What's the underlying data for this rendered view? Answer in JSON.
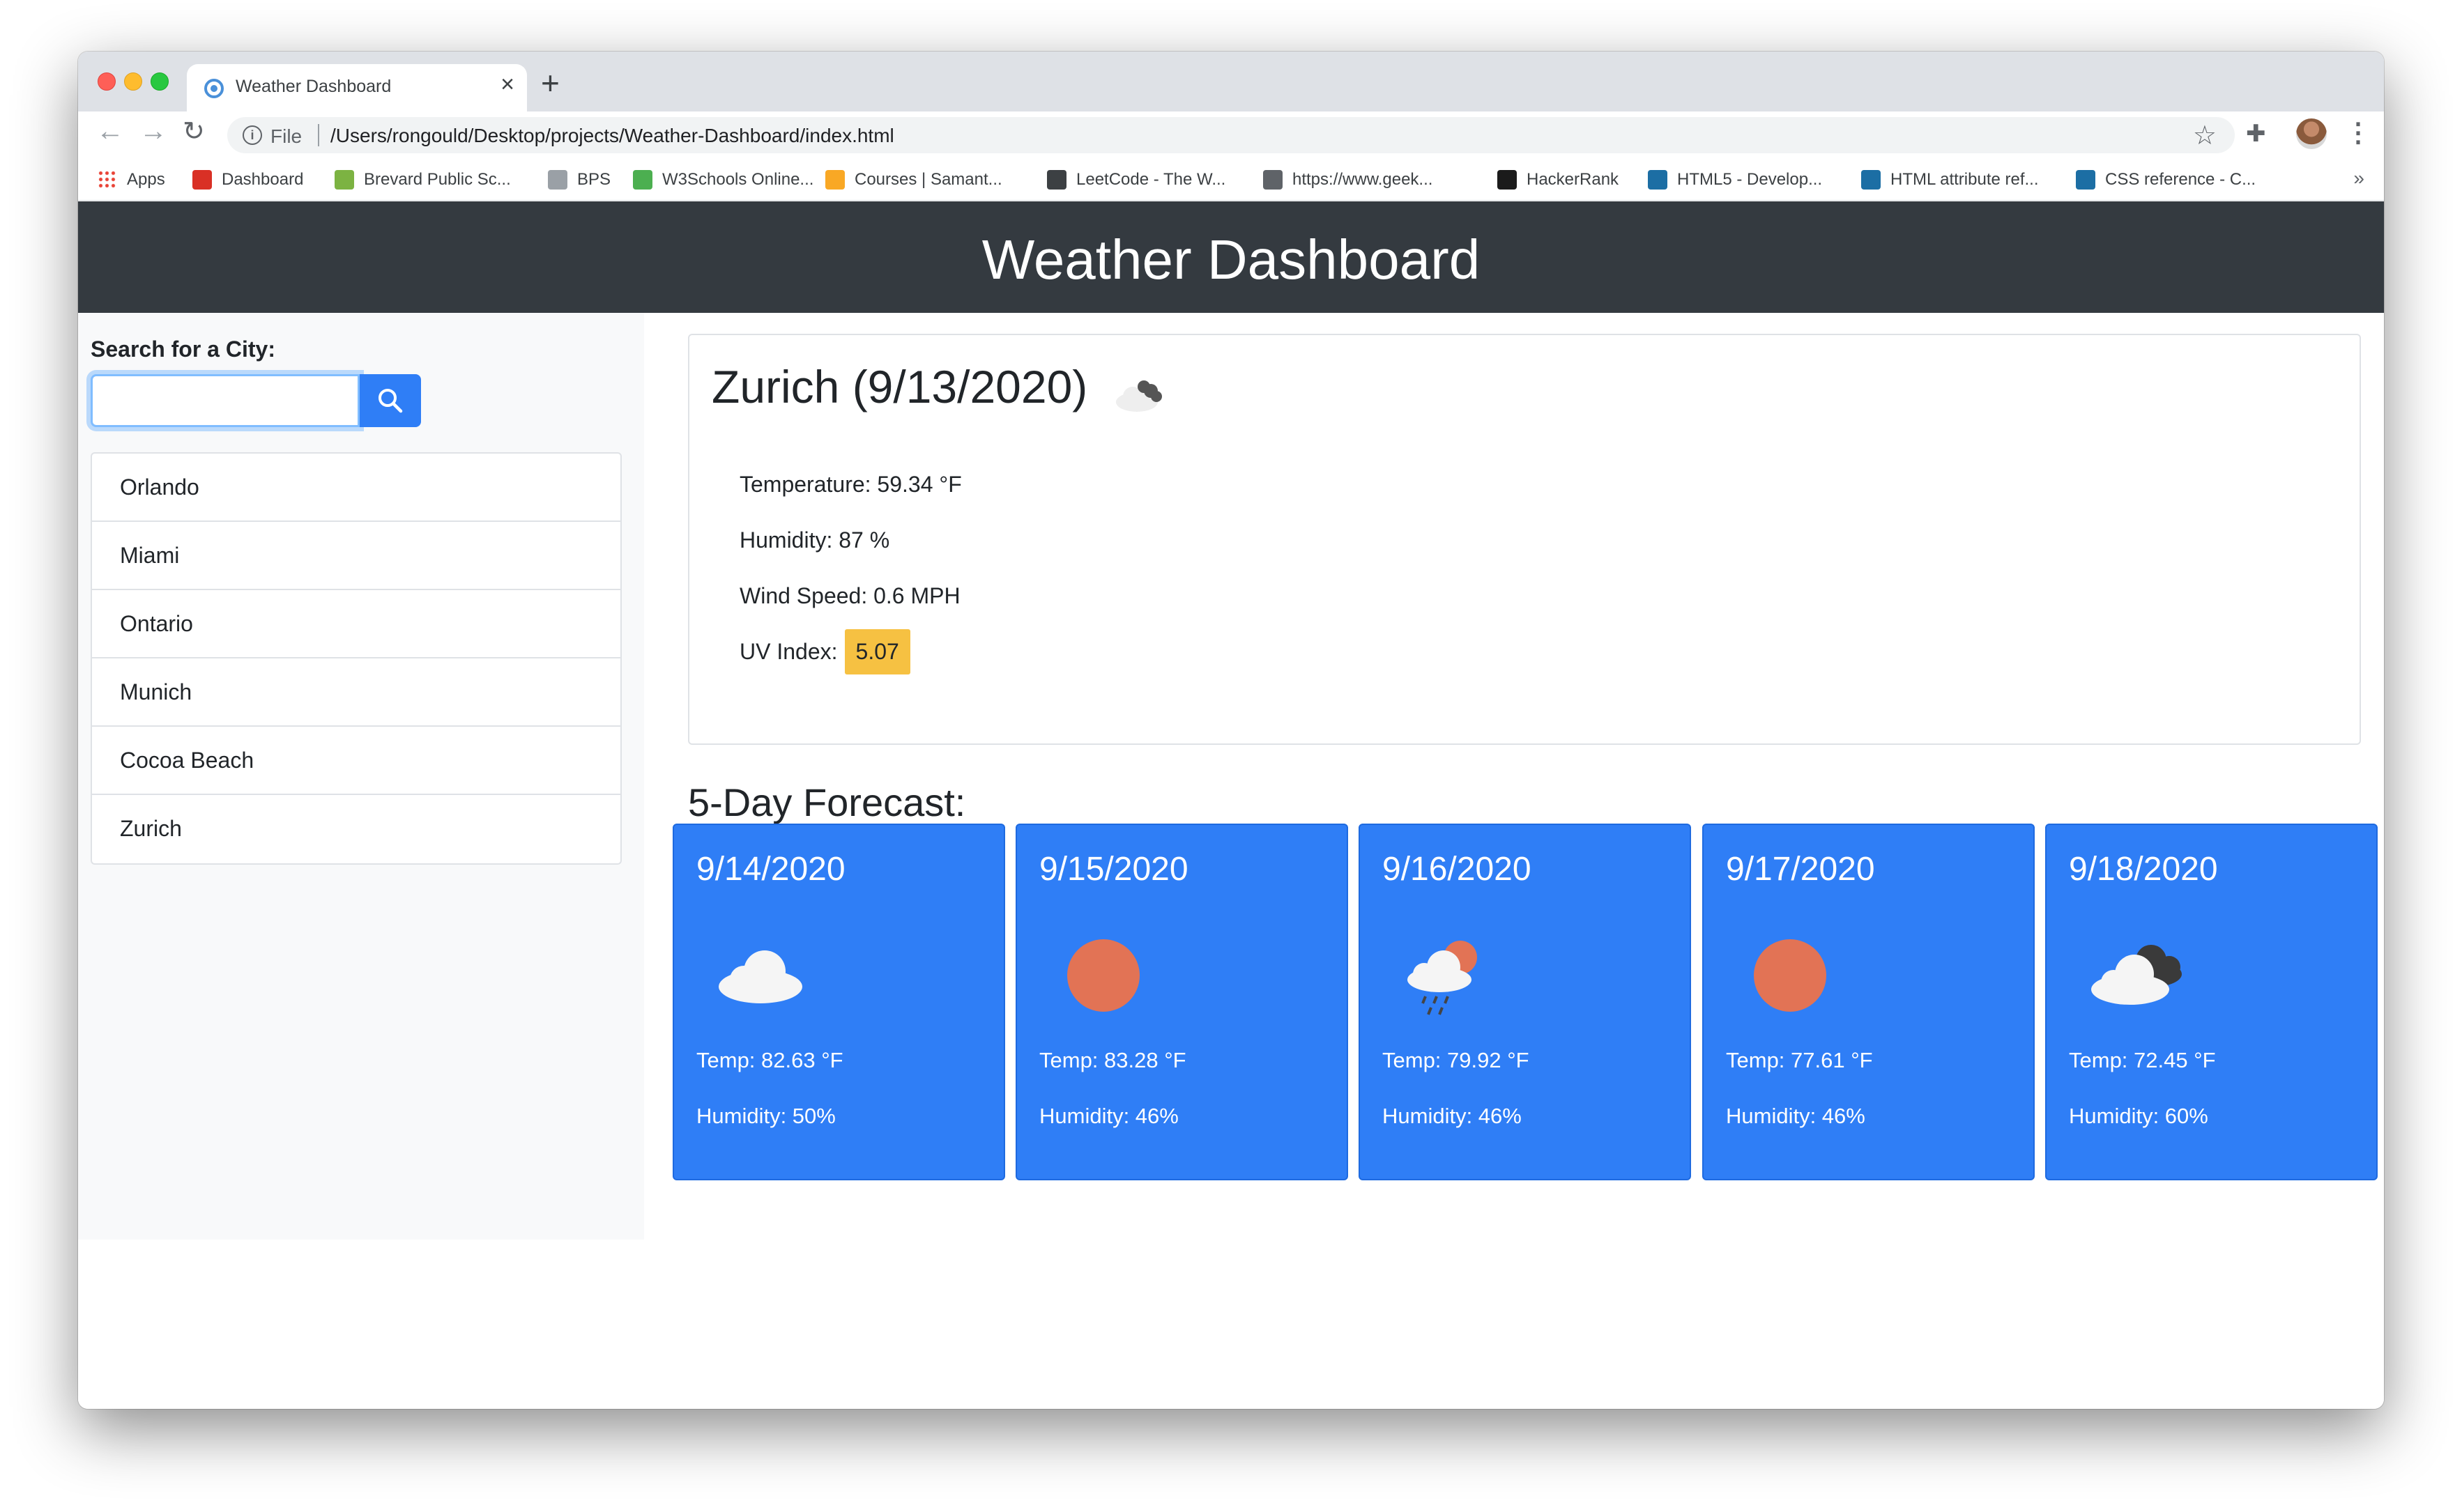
{
  "browser": {
    "tab_title": "Weather Dashboard",
    "tab_close": "×",
    "new_tab": "+",
    "omnibox_scheme": "File",
    "url": "/Users/rongould/Desktop/projects/Weather-Dashboard/index.html",
    "bookmarks": [
      {
        "label": "Apps",
        "icon": "apps-grid-icon",
        "color": "#e94235"
      },
      {
        "label": "Dashboard",
        "icon": "dashboard-icon",
        "color": "#d93025"
      },
      {
        "label": "Brevard Public Sc...",
        "icon": "brevard-icon",
        "color": "#7cb342"
      },
      {
        "label": "BPS",
        "icon": "bps-icon",
        "color": "#9aa0a6"
      },
      {
        "label": "W3Schools Online...",
        "icon": "w3schools-icon",
        "color": "#4caf50"
      },
      {
        "label": "Courses | Samant...",
        "icon": "courses-icon",
        "color": "#f9a825"
      },
      {
        "label": "LeetCode - The W...",
        "icon": "leetcode-icon",
        "color": "#3c4043"
      },
      {
        "label": "https://www.geek...",
        "icon": "globe-icon",
        "color": "#5f6368"
      },
      {
        "label": "HackerRank",
        "icon": "hackerrank-icon",
        "color": "#1b1b1b"
      },
      {
        "label": "HTML5 - Develop...",
        "icon": "mdn-icon",
        "color": "#1c6ea4"
      },
      {
        "label": "HTML attribute ref...",
        "icon": "mdn-icon",
        "color": "#1c6ea4"
      },
      {
        "label": "CSS reference - C...",
        "icon": "mdn-icon",
        "color": "#1c6ea4"
      }
    ],
    "bookmarks_more": "»"
  },
  "header": {
    "title": "Weather Dashboard"
  },
  "sidebar": {
    "search_label": "Search for a City:",
    "search_value": "",
    "cities": [
      "Orlando",
      "Miami",
      "Ontario",
      "Munich",
      "Cocoa Beach",
      "Zurich"
    ]
  },
  "current": {
    "title": "Zurich (9/13/2020)",
    "icon": "broken-clouds-icon",
    "temperature": "Temperature: 59.34 °F",
    "humidity": "Humidity: 87 %",
    "wind": "Wind Speed: 0.6 MPH",
    "uv_label": "UV Index:",
    "uv_value": "5.07",
    "uv_color": "#f6c142"
  },
  "forecast": {
    "title": "5-Day Forecast:",
    "days": [
      {
        "date": "9/14/2020",
        "icon": "cloud-icon",
        "temp": "Temp: 82.63 °F",
        "humidity": "Humidity: 50%"
      },
      {
        "date": "9/15/2020",
        "icon": "sun-icon",
        "temp": "Temp: 83.28 °F",
        "humidity": "Humidity: 46%"
      },
      {
        "date": "9/16/2020",
        "icon": "rain-cloud-sun-icon",
        "temp": "Temp: 79.92 °F",
        "humidity": "Humidity: 46%"
      },
      {
        "date": "9/17/2020",
        "icon": "sun-icon",
        "temp": "Temp: 77.61 °F",
        "humidity": "Humidity: 46%"
      },
      {
        "date": "9/18/2020",
        "icon": "dark-clouds-icon",
        "temp": "Temp: 72.45 °F",
        "humidity": "Humidity: 60%"
      }
    ]
  },
  "colors": {
    "header_bg": "#343a40",
    "primary": "#2f7ef6",
    "sun": "#e27355"
  }
}
